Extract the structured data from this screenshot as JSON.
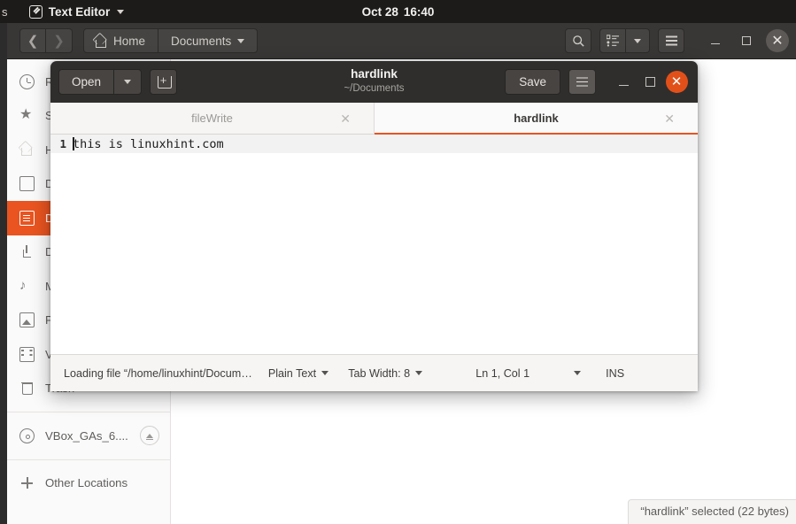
{
  "topbar": {
    "left_truncated": "s",
    "app_name": "Text Editor",
    "app_icon": "pencil-icon",
    "menu_caret": "chevron-down-icon",
    "date": "Oct 28",
    "time": "16:40"
  },
  "nautilus": {
    "nav": {
      "back": "chevron-left-icon",
      "forward": "chevron-right-icon"
    },
    "breadcrumb": [
      {
        "label": "Home",
        "icon": "home-icon"
      },
      {
        "label": "Documents",
        "icon": "chevron-down-icon"
      }
    ],
    "toolbar": {
      "search": "search-icon",
      "view_list": "list-view-icon",
      "view_caret": "chevron-down-icon",
      "menu": "hamburger-menu-icon",
      "minimize": "minimize-icon",
      "maximize": "maximize-icon",
      "close": "close-icon"
    },
    "sidebar": [
      {
        "label": "Recent",
        "icon": "clock-icon",
        "active": false
      },
      {
        "label": "Starred",
        "icon": "star-icon",
        "active": false
      },
      {
        "label": "Home",
        "icon": "home-icon",
        "active": false
      },
      {
        "label": "Desktop",
        "icon": "desktop-icon",
        "active": false
      },
      {
        "label": "Documents",
        "icon": "document-icon",
        "active": true
      },
      {
        "label": "Downloads",
        "icon": "download-icon",
        "active": false
      },
      {
        "label": "Music",
        "icon": "music-icon",
        "active": false
      },
      {
        "label": "Pictures",
        "icon": "picture-icon",
        "active": false
      },
      {
        "label": "Videos",
        "icon": "video-icon",
        "active": false
      },
      {
        "label": "Trash",
        "icon": "trash-icon",
        "active": false
      }
    ],
    "devices": [
      {
        "label": "VBox_GAs_6....",
        "icon": "disc-icon",
        "eject": "eject-icon"
      }
    ],
    "other_locations": {
      "label": "Other Locations",
      "icon": "plus-icon"
    },
    "status_float": "“hardlink” selected  (22 bytes)"
  },
  "gedit": {
    "open_label": "Open",
    "open_caret": "chevron-down-icon",
    "new_tab_icon": "new-tab-icon",
    "title": "hardlink",
    "subtitle": "~/Documents",
    "save_label": "Save",
    "menu_icon": "hamburger-menu-icon",
    "minimize_icon": "minimize-icon",
    "maximize_icon": "maximize-icon",
    "close_icon": "close-icon",
    "close_glyph": "✕",
    "tabs": [
      {
        "label": "fileWrite",
        "active": false,
        "close": "✕"
      },
      {
        "label": "hardlink",
        "active": true,
        "close": "✕"
      }
    ],
    "editor": {
      "lines": [
        {
          "number": "1",
          "text": "this is linuxhint.com"
        }
      ]
    },
    "statusbar": {
      "file_message": "Loading file “/home/linuxhint/Docum…",
      "language": "Plain Text",
      "tab_width": "Tab Width: 8",
      "position": "Ln 1, Col 1",
      "insert_mode": "INS"
    }
  },
  "colors": {
    "accent": "#e95420",
    "topbar_bg": "#1d1b19",
    "header_bg": "#393736",
    "gedit_header_bg": "#302e2c"
  }
}
